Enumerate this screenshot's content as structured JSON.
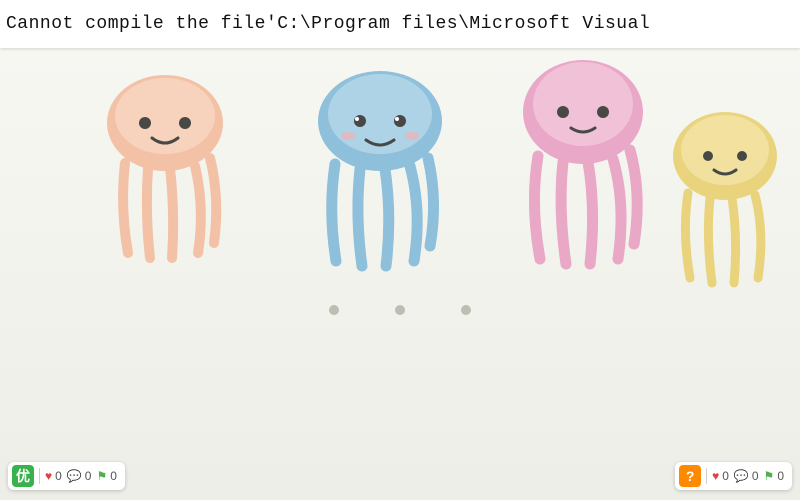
{
  "header": {
    "path_text": "Cannot compile the file'C:\\Program files\\Microsoft Visual"
  },
  "badges": {
    "left": {
      "icon_label": "优",
      "likes": "0",
      "comments": "0",
      "flags": "0"
    },
    "right": {
      "icon_label": "?",
      "likes": "0",
      "comments": "0",
      "flags": "0"
    }
  }
}
